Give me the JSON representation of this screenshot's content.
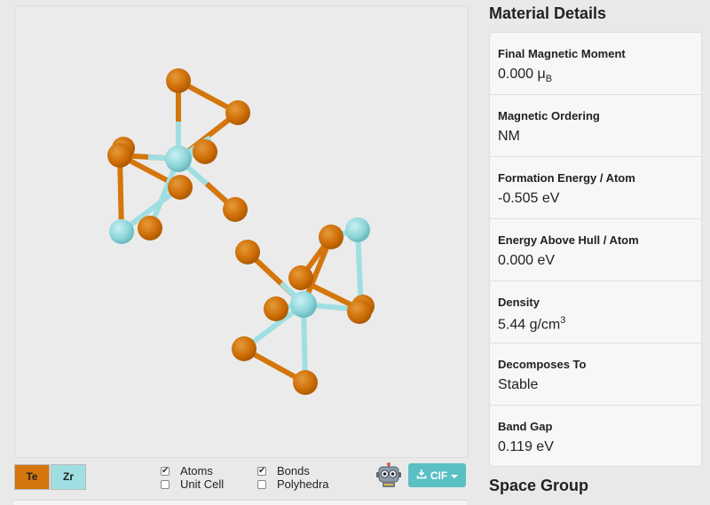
{
  "viewer": {
    "legend": [
      {
        "symbol": "Te",
        "color": "#d4760c"
      },
      {
        "symbol": "Zr",
        "color": "#9fdfe2"
      }
    ],
    "toggles": [
      {
        "label": "Atoms",
        "checked": true
      },
      {
        "label": "Unit Cell",
        "checked": false
      },
      {
        "label": "Bonds",
        "checked": true
      },
      {
        "label": "Polyhedra",
        "checked": false
      }
    ],
    "assistant_icon": "robot-icon",
    "download": {
      "label": "CIF",
      "icon": "download-icon"
    }
  },
  "details": {
    "title": "Material Details",
    "properties": [
      {
        "label": "Final Magnetic Moment",
        "value": "0.000 μ",
        "sub": "B"
      },
      {
        "label": "Magnetic Ordering",
        "value": "NM"
      },
      {
        "label": "Formation Energy / Atom",
        "value": "-0.505 eV"
      },
      {
        "label": "Energy Above Hull / Atom",
        "value": "0.000 eV"
      },
      {
        "label": "Density",
        "value": "5.44 g/cm",
        "sup": "3"
      },
      {
        "label": "Decomposes To",
        "value": "Stable"
      },
      {
        "label": "Band Gap",
        "value": "0.119 eV"
      }
    ]
  },
  "next_section": {
    "title": "Space Group"
  },
  "colors": {
    "te": "#d4760c",
    "zr": "#8fd6da",
    "accent": "#5bc0c4"
  }
}
